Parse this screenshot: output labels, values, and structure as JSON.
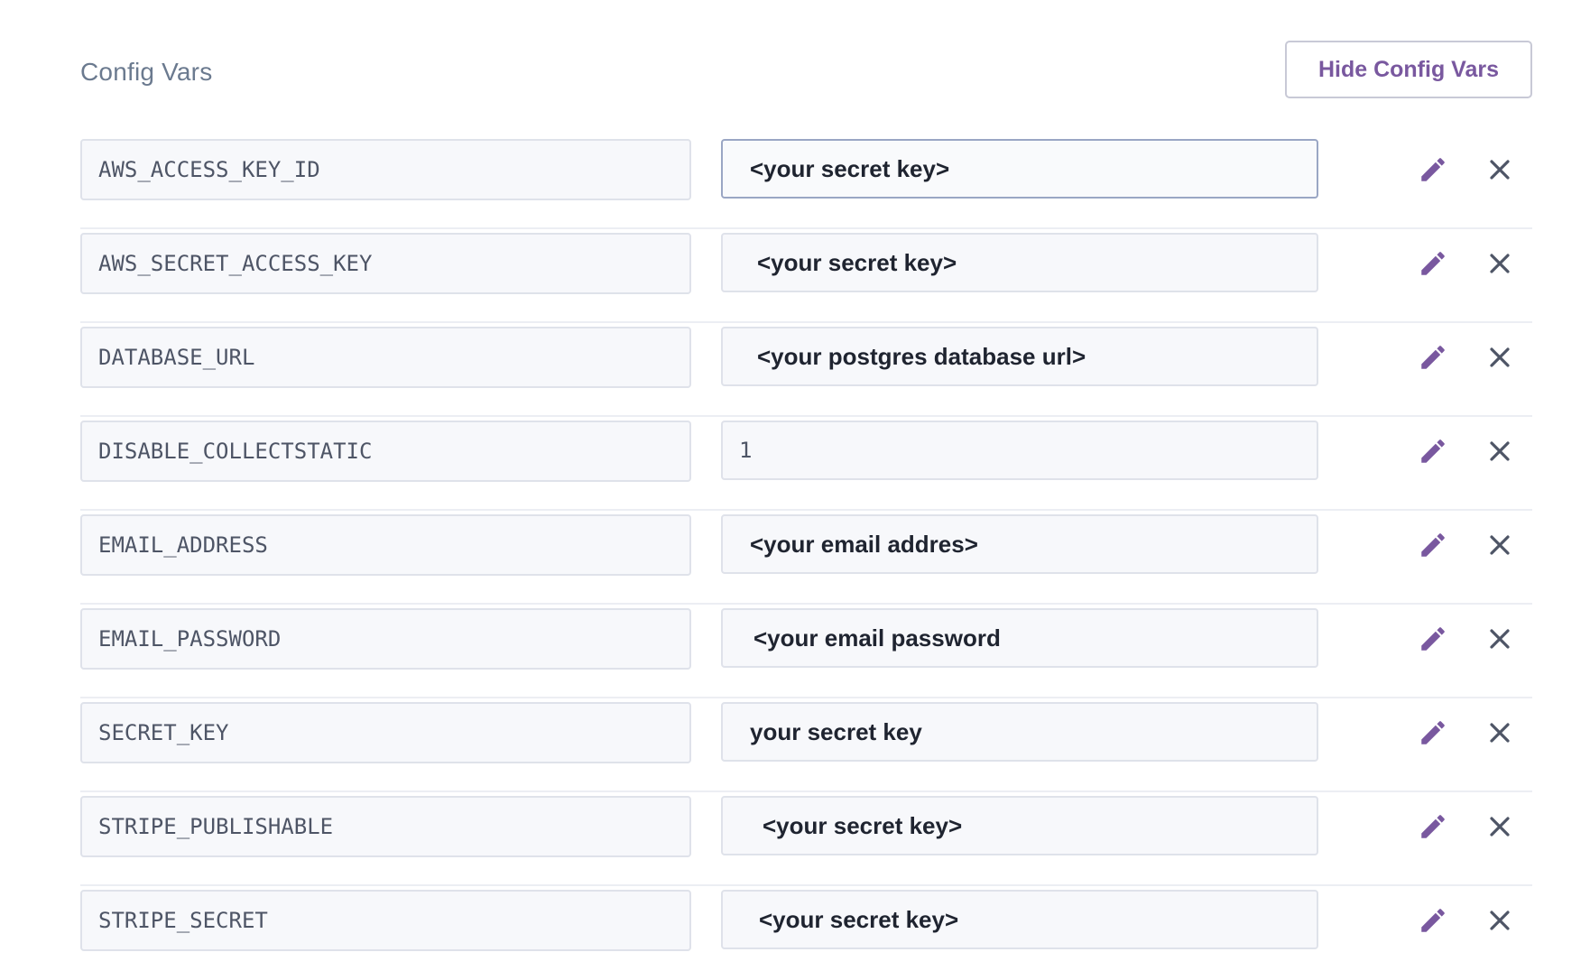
{
  "header": {
    "title": "Config Vars",
    "hide_button_label": "Hide Config Vars"
  },
  "colors": {
    "accent": "#79589f",
    "muted_text": "#6b7a8f",
    "delete_icon": "#4e5566"
  },
  "icons": {
    "edit": "pencil-icon",
    "delete": "close-icon"
  },
  "config_vars": [
    {
      "key": "AWS_ACCESS_KEY_ID",
      "value": "<your secret key>"
    },
    {
      "key": "AWS_SECRET_ACCESS_KEY",
      "value": "<your secret key>"
    },
    {
      "key": "DATABASE_URL",
      "value": "<your postgres database url>"
    },
    {
      "key": "DISABLE_COLLECTSTATIC",
      "value": "1"
    },
    {
      "key": "EMAIL_ADDRESS",
      "value": "<your email addres>"
    },
    {
      "key": "EMAIL_PASSWORD",
      "value": "<your email password"
    },
    {
      "key": "SECRET_KEY",
      "value": "your secret key"
    },
    {
      "key": "STRIPE_PUBLISHABLE",
      "value": "<your secret key>"
    },
    {
      "key": "STRIPE_SECRET",
      "value": "<your secret key>"
    }
  ]
}
